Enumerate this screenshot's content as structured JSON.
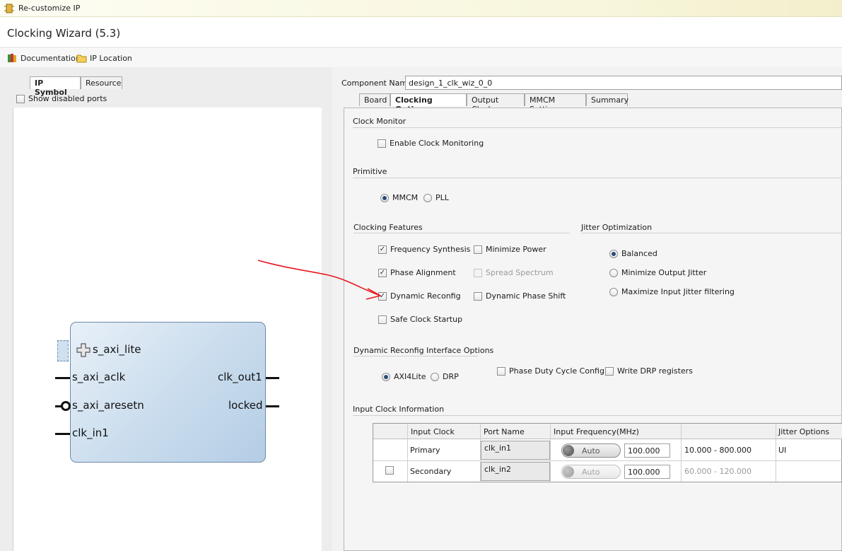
{
  "window": {
    "title": "Re-customize IP"
  },
  "header": {
    "title": "Clocking Wizard (5.3)"
  },
  "toolbar": {
    "documentation": "Documentation",
    "ip_location": "IP Location"
  },
  "left": {
    "tabs": [
      {
        "label": "IP Symbol",
        "active": true
      },
      {
        "label": "Resource",
        "active": false
      }
    ],
    "show_disabled_ports": "Show disabled ports",
    "ports_left": [
      "s_axi_lite",
      "s_axi_aclk",
      "s_axi_aresetn",
      "clk_in1"
    ],
    "ports_right": [
      "clk_out1",
      "locked"
    ]
  },
  "right": {
    "component_name_label": "Component Name",
    "component_name_value": "design_1_clk_wiz_0_0",
    "tabs": [
      {
        "label": "Board",
        "active": false
      },
      {
        "label": "Clocking Options",
        "active": true
      },
      {
        "label": "Output Clocks",
        "active": false
      },
      {
        "label": "MMCM Settings",
        "active": false
      },
      {
        "label": "Summary",
        "active": false
      }
    ],
    "clock_monitor": {
      "title": "Clock Monitor",
      "enable": "Enable Clock Monitoring"
    },
    "primitive": {
      "title": "Primitive",
      "mmcm": "MMCM",
      "pll": "PLL",
      "selected": "MMCM"
    },
    "clocking_features": {
      "title": "Clocking Features",
      "frequency_synthesis": "Frequency Synthesis",
      "minimize_power": "Minimize Power",
      "phase_alignment": "Phase Alignment",
      "spread_spectrum": "Spread Spectrum",
      "dynamic_reconfig": "Dynamic Reconfig",
      "dynamic_phase_shift": "Dynamic Phase Shift",
      "safe_clock_startup": "Safe Clock Startup"
    },
    "jitter_optimization": {
      "title": "Jitter Optimization",
      "balanced": "Balanced",
      "minimize_output_jitter": "Minimize Output Jitter",
      "maximize_input_jitter": "Maximize Input Jitter filtering",
      "selected": "Balanced"
    },
    "dynamic_reconfig_interface": {
      "title": "Dynamic Reconfig Interface Options",
      "axi4lite": "AXI4Lite",
      "drp": "DRP",
      "phase_duty_cycle": "Phase Duty Cycle Config",
      "write_drp": "Write DRP registers",
      "selected": "AXI4Lite"
    },
    "input_clock_info": {
      "title": "Input Clock Information",
      "headers": [
        "",
        "Input Clock",
        "Port Name",
        "Input Frequency(MHz)",
        "",
        "Jitter Options"
      ],
      "rows": [
        {
          "input_clock": "Primary",
          "port_name": "clk_in1",
          "toggle": "Auto",
          "freq": "100.000",
          "range": "10.000 - 800.000",
          "jitter": "UI"
        },
        {
          "input_clock": "Secondary",
          "port_name": "clk_in2",
          "toggle": "Auto",
          "freq": "100.000",
          "range": "60.000 - 120.000",
          "jitter": ""
        }
      ]
    }
  }
}
